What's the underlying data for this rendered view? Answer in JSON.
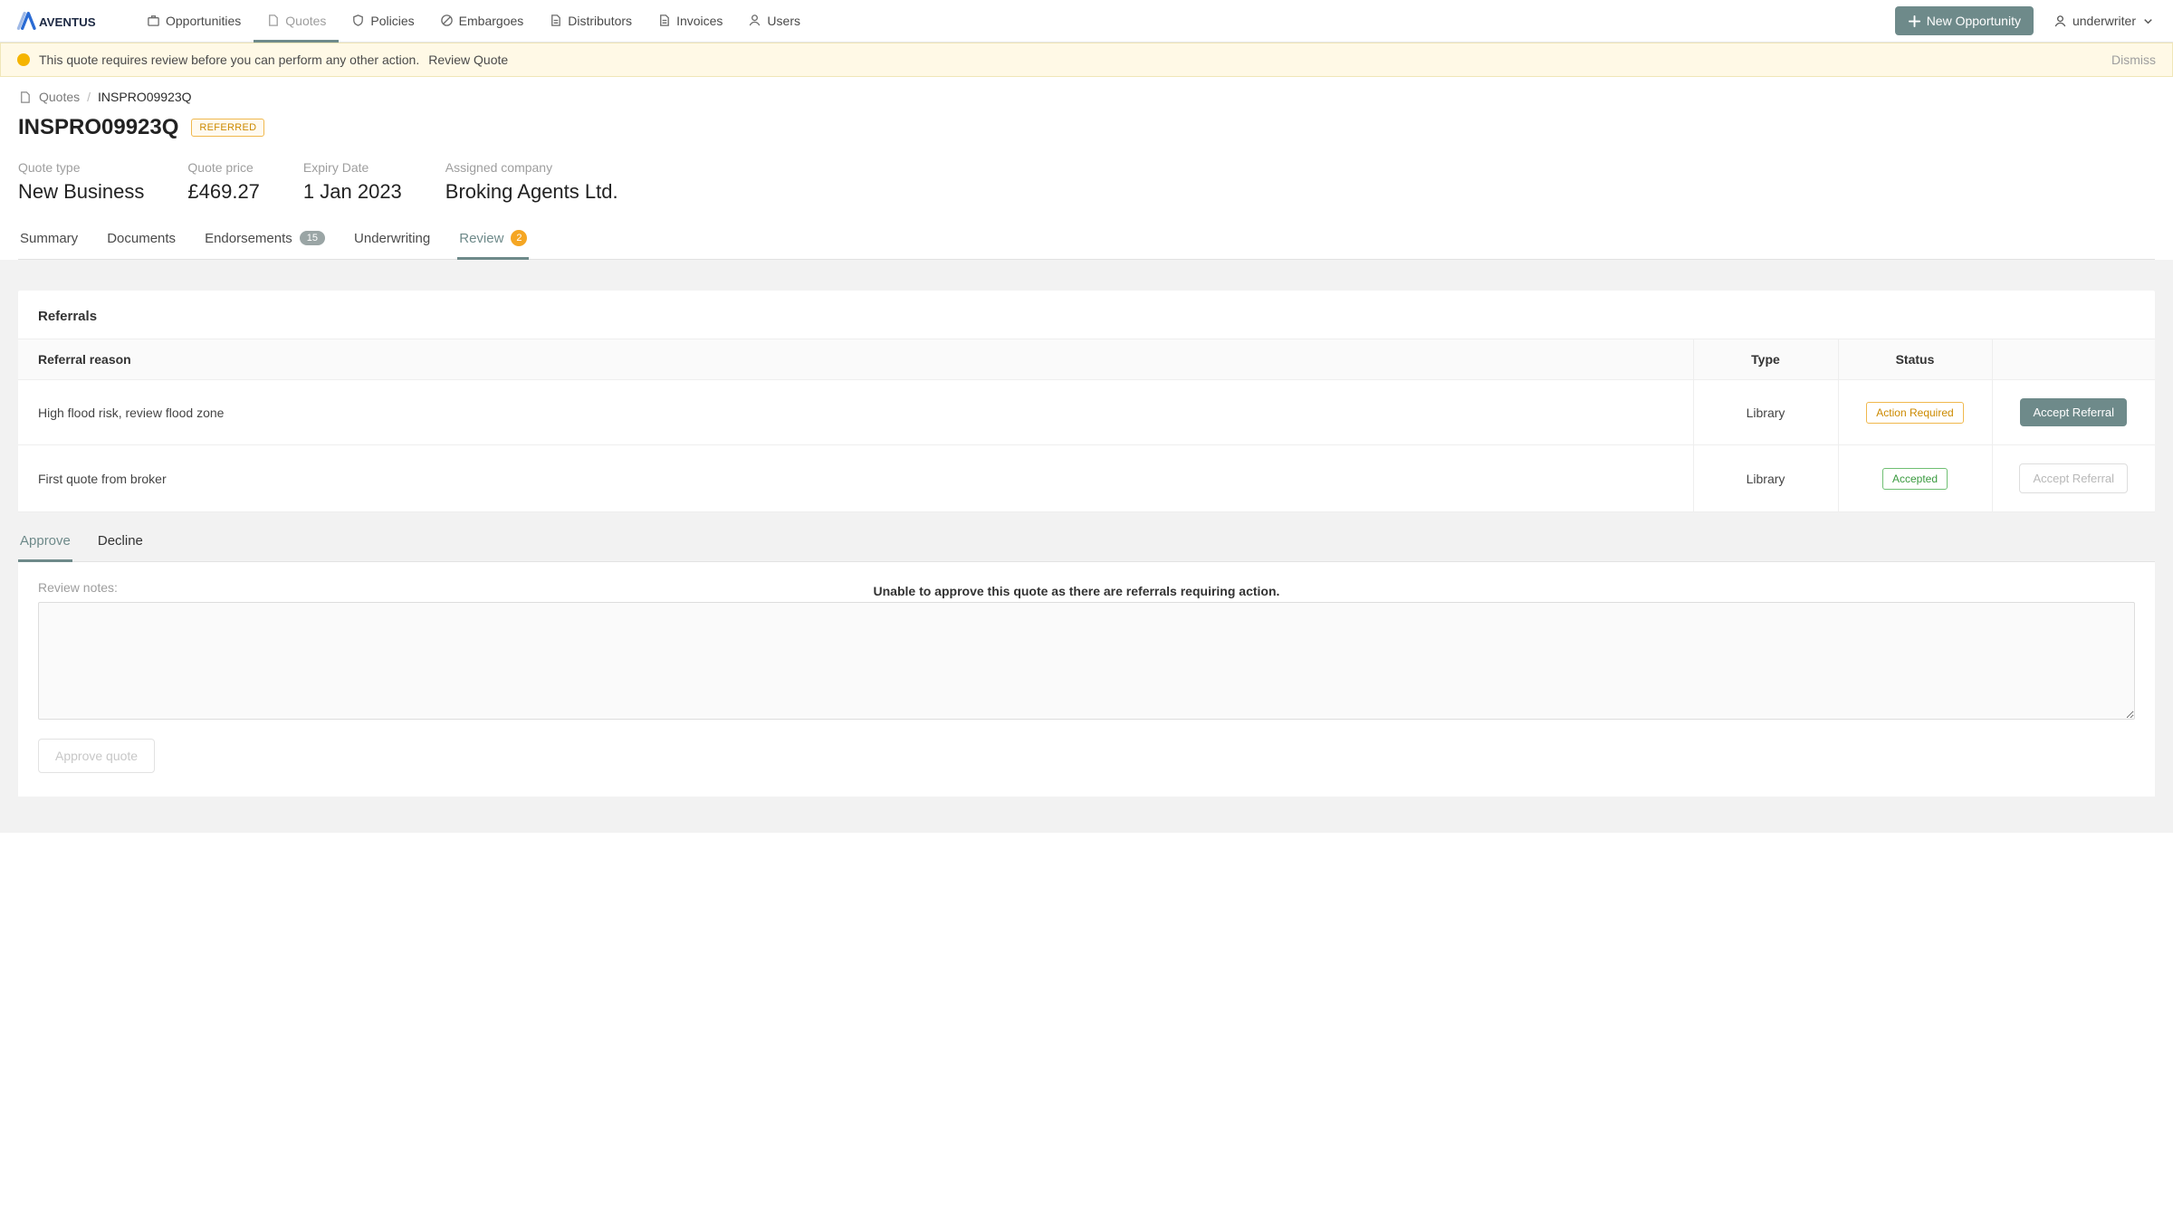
{
  "brand": "AVENTUS",
  "nav": [
    {
      "label": "Opportunities",
      "icon": "briefcase"
    },
    {
      "label": "Quotes",
      "icon": "file",
      "active": true
    },
    {
      "label": "Policies",
      "icon": "shield"
    },
    {
      "label": "Embargoes",
      "icon": "ban"
    },
    {
      "label": "Distributors",
      "icon": "doc"
    },
    {
      "label": "Invoices",
      "icon": "doc"
    },
    {
      "label": "Users",
      "icon": "user"
    }
  ],
  "header_actions": {
    "new_opportunity": "New Opportunity",
    "user_label": "underwriter"
  },
  "alert": {
    "text": "This quote requires review before you can perform any other action.",
    "link": "Review Quote",
    "dismiss": "Dismiss"
  },
  "breadcrumb": {
    "root": "Quotes",
    "current": "INSPRO09923Q"
  },
  "quote": {
    "id": "INSPRO09923Q",
    "status": "REFERRED",
    "meta": [
      {
        "label": "Quote type",
        "value": "New Business"
      },
      {
        "label": "Quote price",
        "value": "£469.27"
      },
      {
        "label": "Expiry Date",
        "value": "1 Jan 2023"
      },
      {
        "label": "Assigned company",
        "value": "Broking Agents Ltd."
      }
    ]
  },
  "tabs": [
    {
      "label": "Summary"
    },
    {
      "label": "Documents"
    },
    {
      "label": "Endorsements",
      "count": "15"
    },
    {
      "label": "Underwriting"
    },
    {
      "label": "Review",
      "badge": "2",
      "active": true
    }
  ],
  "referrals": {
    "title": "Referrals",
    "columns": {
      "reason": "Referral reason",
      "type": "Type",
      "status": "Status"
    },
    "rows": [
      {
        "reason": "High flood risk, review flood zone",
        "type": "Library",
        "status": "Action Required",
        "status_kind": "amber",
        "action": "Accept Referral",
        "action_enabled": true
      },
      {
        "reason": "First quote from broker",
        "type": "Library",
        "status": "Accepted",
        "status_kind": "green",
        "action": "Accept Referral",
        "action_enabled": false
      }
    ]
  },
  "review_panel": {
    "sub_tabs": [
      {
        "label": "Approve",
        "active": true
      },
      {
        "label": "Decline"
      }
    ],
    "notes_label": "Review notes:",
    "warning": "Unable to approve this quote as there are referrals requiring action.",
    "approve_button": "Approve quote"
  }
}
